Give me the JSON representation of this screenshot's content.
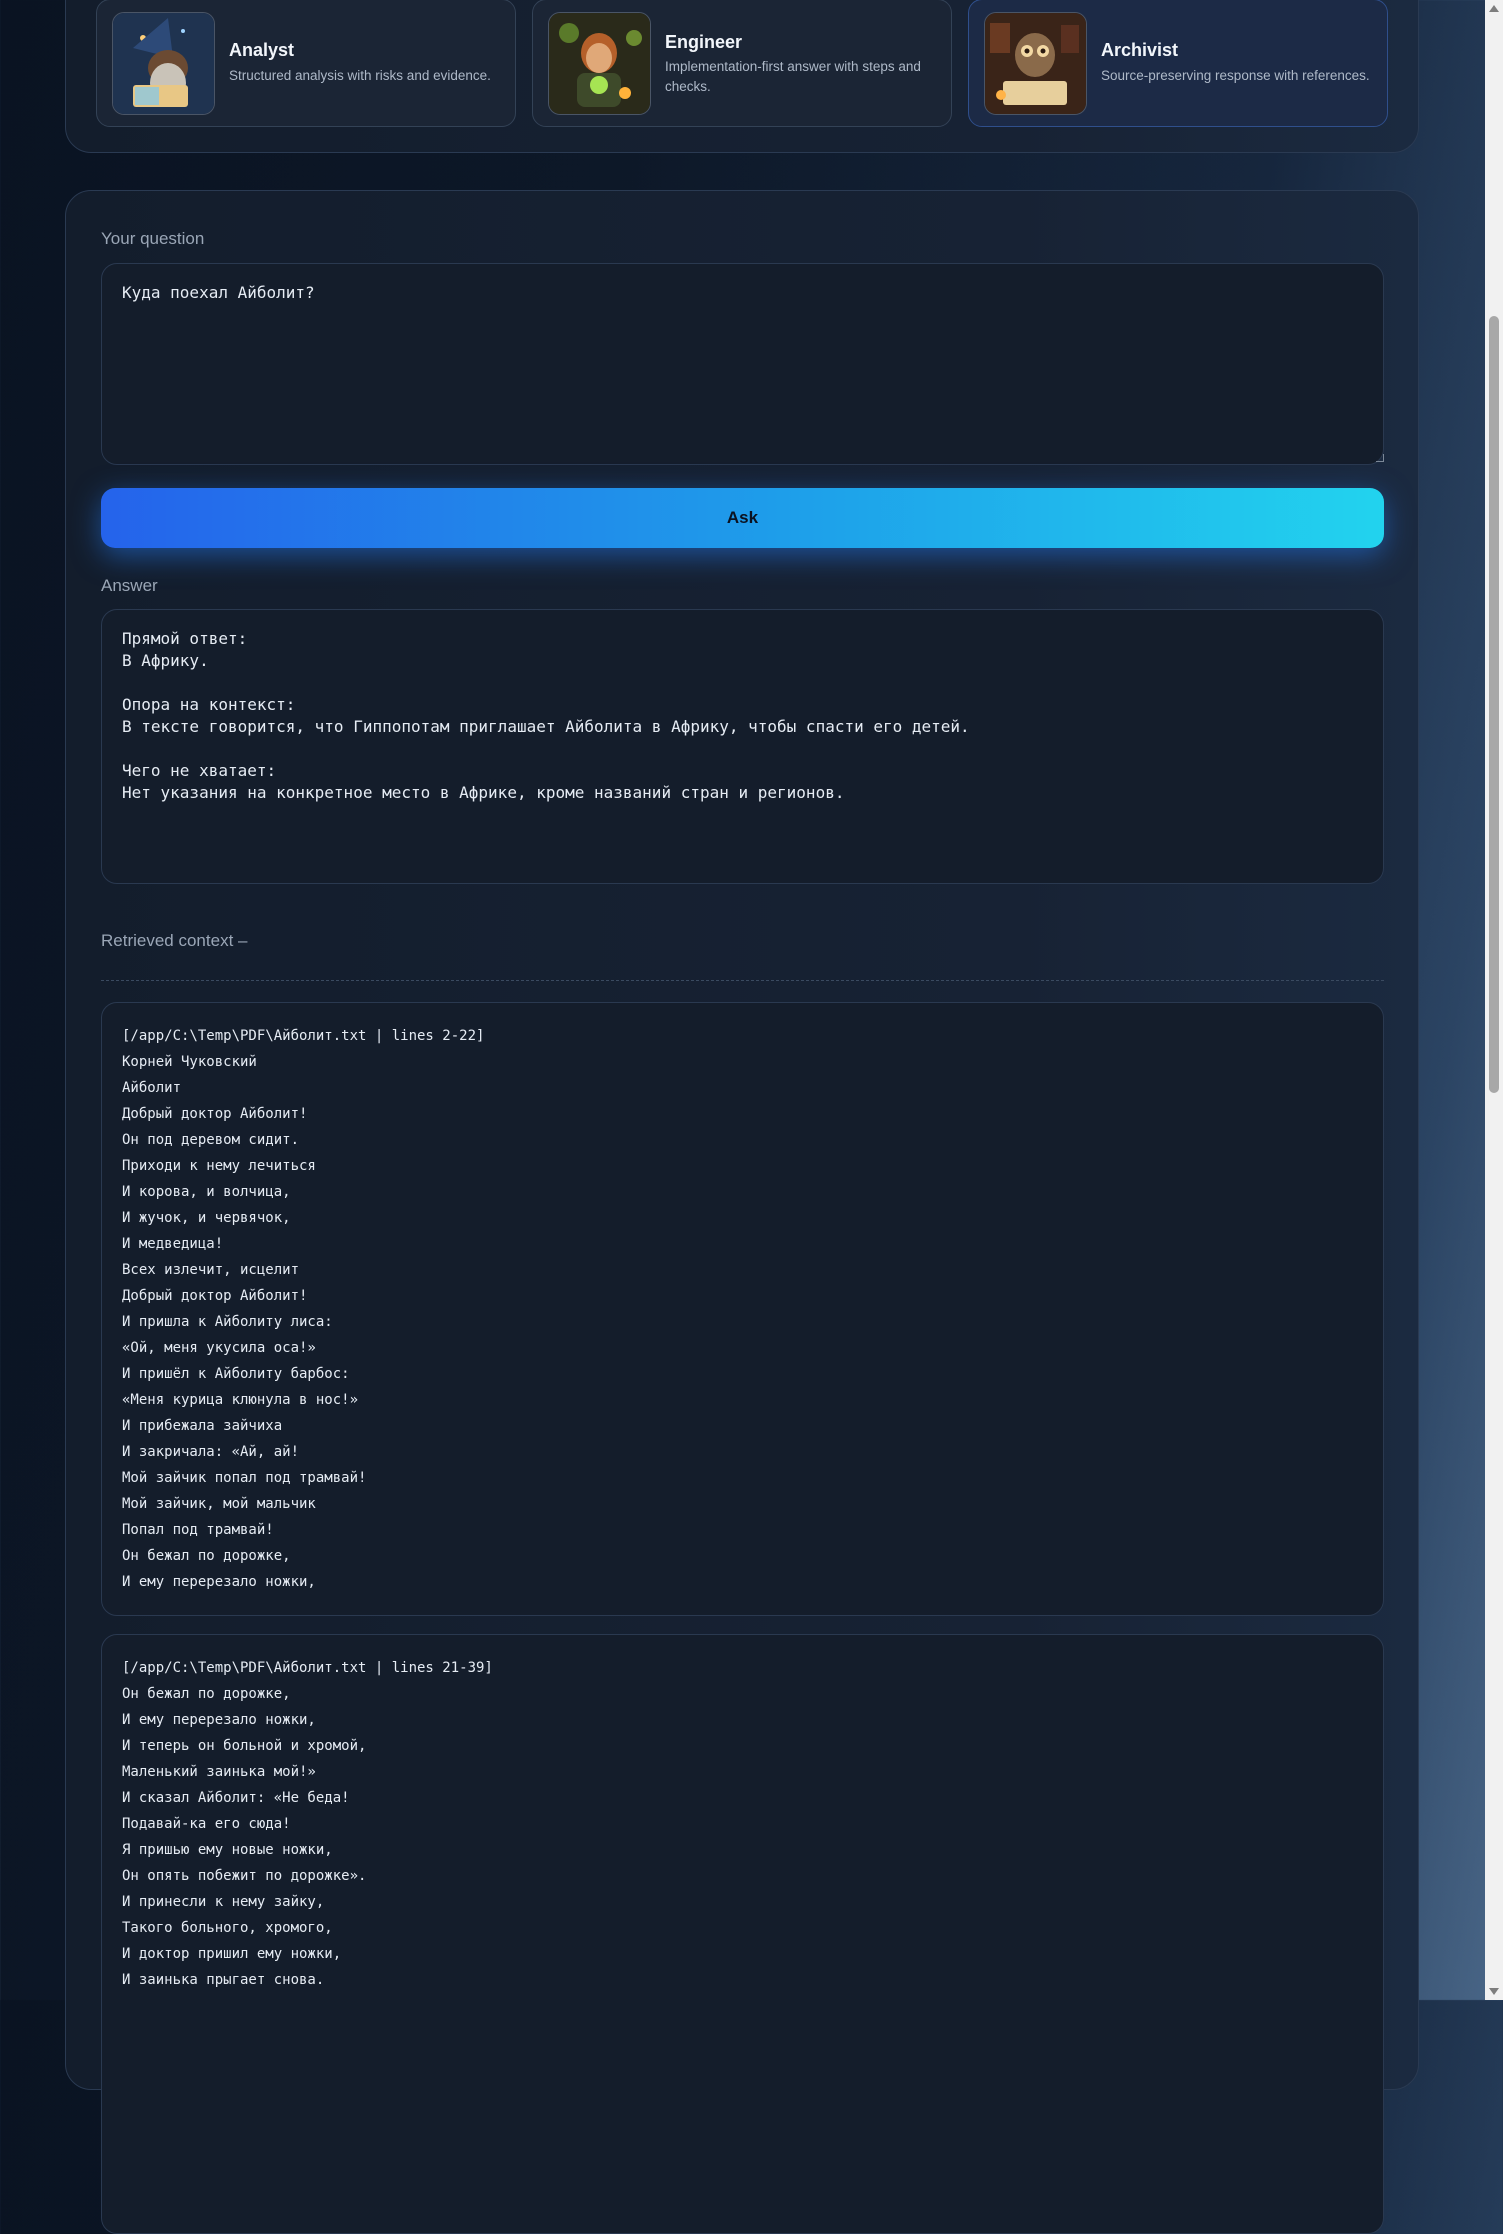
{
  "personas": [
    {
      "title": "Analyst",
      "description": "Structured analysis with risks and evidence.",
      "icon": "wizard-reading-icon"
    },
    {
      "title": "Engineer",
      "description": "Implementation-first answer with steps and checks.",
      "icon": "alchemist-engineer-icon"
    },
    {
      "title": "Archivist",
      "description": "Source-preserving response with references.",
      "icon": "owl-archivist-icon",
      "selected": true
    }
  ],
  "question": {
    "label": "Your question",
    "value": "Куда поехал Айболит?"
  },
  "ask_label": "Ask",
  "answer": {
    "label": "Answer",
    "text": "Прямой ответ:\nВ Африку.\n\nОпора на контекст:\nВ тексте говорится, что Гиппопотам приглашает Айболита в Африку, чтобы спасти его детей.\n\nЧего не хватает:\nНет указания на конкретное место в Африке, кроме названий стран и регионов."
  },
  "retrieved": {
    "label": "Retrieved context –",
    "chunks": [
      {
        "text": "[/app/C:\\Temp\\PDF\\Айболит.txt | lines 2-22]\nКорней Чуковский\nАйболит\nДобрый доктор Айболит!\nОн под деревом сидит.\nПриходи к нему лечиться\nИ корова, и волчица,\nИ жучок, и червячок,\nИ медведица!\nВсех излечит, исцелит\nДобрый доктор Айболит!\nИ пришла к Айболиту лиса:\n«Ой, меня укусила оса!»\nИ пришёл к Айболиту барбос:\n«Меня курица клюнула в нос!»\nИ прибежала зайчиха\nИ закричала: «Ай, ай!\nМой зайчик попал под трамвай!\nМой зайчик, мой мальчик\nПопал под трамвай!\nОн бежал по дорожке,\nИ ему перерезало ножки,"
      },
      {
        "text": "[/app/C:\\Temp\\PDF\\Айболит.txt | lines 21-39]\nОн бежал по дорожке,\nИ ему перерезало ножки,\nИ теперь он больной и хромой,\nМаленький заинька мой!»\nИ сказал Айболит: «Не беда!\nПодавай-ка его сюда!\nЯ пришью ему новые ножки,\nОн опять побежит по дорожке».\nИ принесли к нему зайку,\nТакого больного, хромого,\nИ доктор пришил ему ножки,\nИ заинька прыгает снова."
      }
    ]
  }
}
